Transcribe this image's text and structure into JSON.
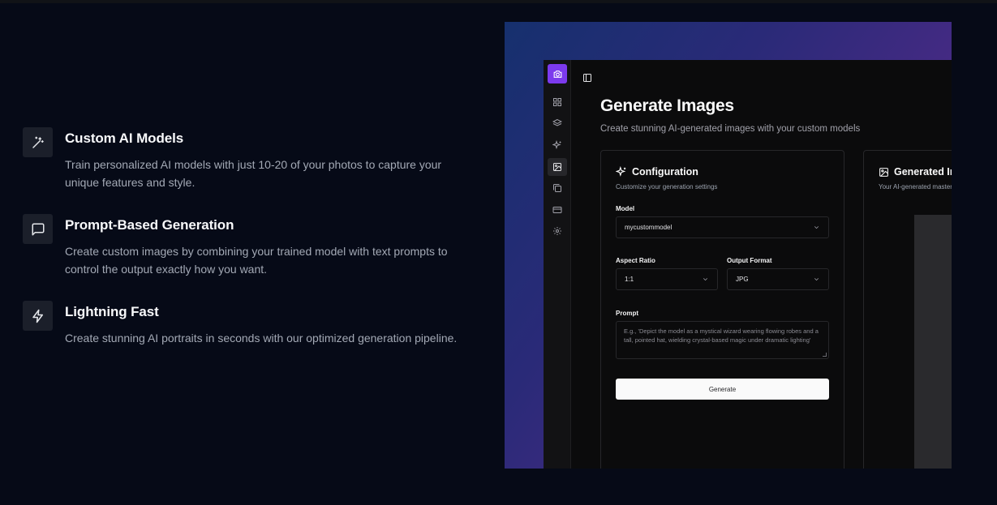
{
  "features": [
    {
      "icon": "magic-wand-icon",
      "title": "Custom AI Models",
      "description": "Train personalized AI models with just 10-20 of your photos to capture your unique features and style."
    },
    {
      "icon": "message-square-icon",
      "title": "Prompt-Based Generation",
      "description": "Create custom images by combining your trained model with text prompts to control the output exactly how you want."
    },
    {
      "icon": "lightning-icon",
      "title": "Lightning Fast",
      "description": "Create stunning AI portraits in seconds with our optimized generation pipeline."
    }
  ],
  "app": {
    "accent_color": "#7c3aed",
    "page_title": "Generate Images",
    "page_subtitle": "Create stunning AI-generated images with your custom models",
    "rail_icons": [
      "camera-icon",
      "grid-icon",
      "layers-icon",
      "sparkles-icon",
      "image-icon",
      "images-icon",
      "credit-card-icon",
      "gear-icon"
    ],
    "config": {
      "title": "Configuration",
      "subtitle": "Customize your generation settings",
      "model_label": "Model",
      "model_value": "mycustommodel",
      "aspect_label": "Aspect Ratio",
      "aspect_value": "1:1",
      "format_label": "Output Format",
      "format_value": "JPG",
      "prompt_label": "Prompt",
      "prompt_placeholder": "E.g., 'Depict the model as a mystical wizard wearing flowing robes and a tall, pointed hat, wielding crystal-based magic under dramatic lighting'",
      "generate_label": "Generate"
    },
    "output": {
      "title": "Generated Images",
      "subtitle": "Your AI-generated masterpieces"
    }
  }
}
